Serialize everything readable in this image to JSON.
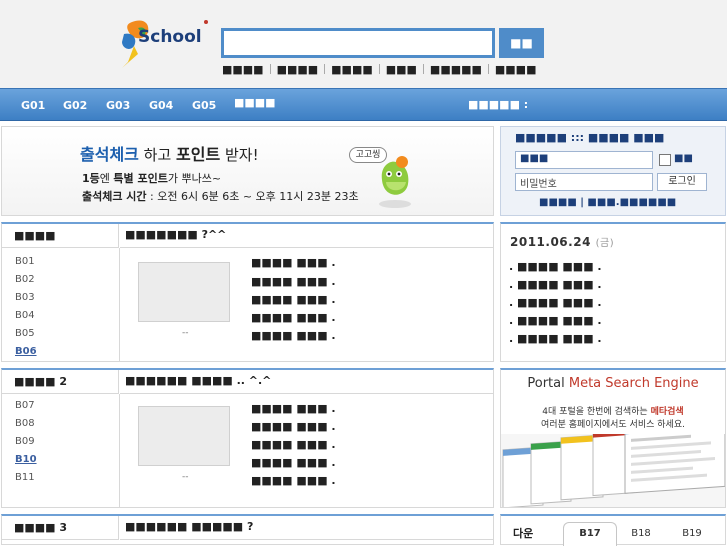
{
  "header": {
    "logo_text": "School",
    "search_value": "",
    "search_button": "■■",
    "quick_links": [
      "■■■■",
      "■■■■",
      "■■■■",
      "■■■",
      "■■■■■",
      "■■■■"
    ]
  },
  "nav": {
    "items": [
      "G01",
      "G02",
      "G03",
      "G04",
      "G05",
      "■■■■"
    ],
    "right_text": "■■■■■ :"
  },
  "banner": {
    "line1_part1": "출석체크",
    "line1_part2": " 하고 ",
    "line1_part3": "포인트",
    "line1_part4": " 받자!",
    "line2_bold1": "1등",
    "line2_text1": "엔 ",
    "line2_bold2": "특별 포인트",
    "line2_text2": "가 뿌나쓰~",
    "line3_bold": "출석체크 시간",
    "line3_text": " : 오전 6시 6분 6초 ~ 오후 11시 23분 23초",
    "bubble": "고고씽"
  },
  "login": {
    "title": "■■■■■ ::: ■■■■ ■■■",
    "id_value": "■■■",
    "password_placeholder": "비밀번호",
    "remember_label": "■■",
    "login_button": "로그인",
    "links_left": "■■■■",
    "links_sep": "|",
    "links_right": "■■■.■■■■■■"
  },
  "block1": {
    "left_title": "■■■■",
    "right_title": "■■■■■■■ ?^^",
    "categories": [
      "B01",
      "B02",
      "B03",
      "B04",
      "B05",
      "B06"
    ],
    "dash": "--",
    "articles": [
      "■■■■ ■■■ .",
      "■■■■ ■■■ .",
      "■■■■ ■■■ .",
      "■■■■ ■■■ .",
      "■■■■ ■■■ ."
    ]
  },
  "block2": {
    "left_title": "■■■■ 2",
    "right_title": "■■■■■■ ■■■■ .. ^.^",
    "categories": [
      "B07",
      "B08",
      "B09",
      "B10",
      "B11"
    ],
    "dash": "--",
    "articles": [
      "■■■■ ■■■ .",
      "■■■■ ■■■ .",
      "■■■■ ■■■ .",
      "■■■■ ■■■ .",
      "■■■■ ■■■ ."
    ]
  },
  "block3": {
    "left_title": "■■■■ 3",
    "right_title": "■■■■■■ ■■■■■ ?"
  },
  "datebox": {
    "date": "2011.06.24",
    "weekday": "(금)",
    "lines": [
      ". ■■■■ ■■■ .",
      ". ■■■■ ■■■ .",
      ". ■■■■ ■■■ .",
      ". ■■■■ ■■■ .",
      ". ■■■■ ■■■ ."
    ]
  },
  "meta": {
    "title_part1": "Portal ",
    "title_part2": "Meta Search Engine",
    "desc1_part1": "4대 포털을 한번에 검색하는 ",
    "desc1_part2": "메타검색",
    "desc2": "여러분 홈페이지에서도 서비스 하세요."
  },
  "tabs": {
    "label": "다운",
    "items": [
      "B17",
      "B18",
      "B19"
    ],
    "active": "B17"
  },
  "colors": {
    "nav_blue": "#4f8cc9",
    "accent_red": "#c0392b",
    "link_blue": "#3b5fa0"
  }
}
